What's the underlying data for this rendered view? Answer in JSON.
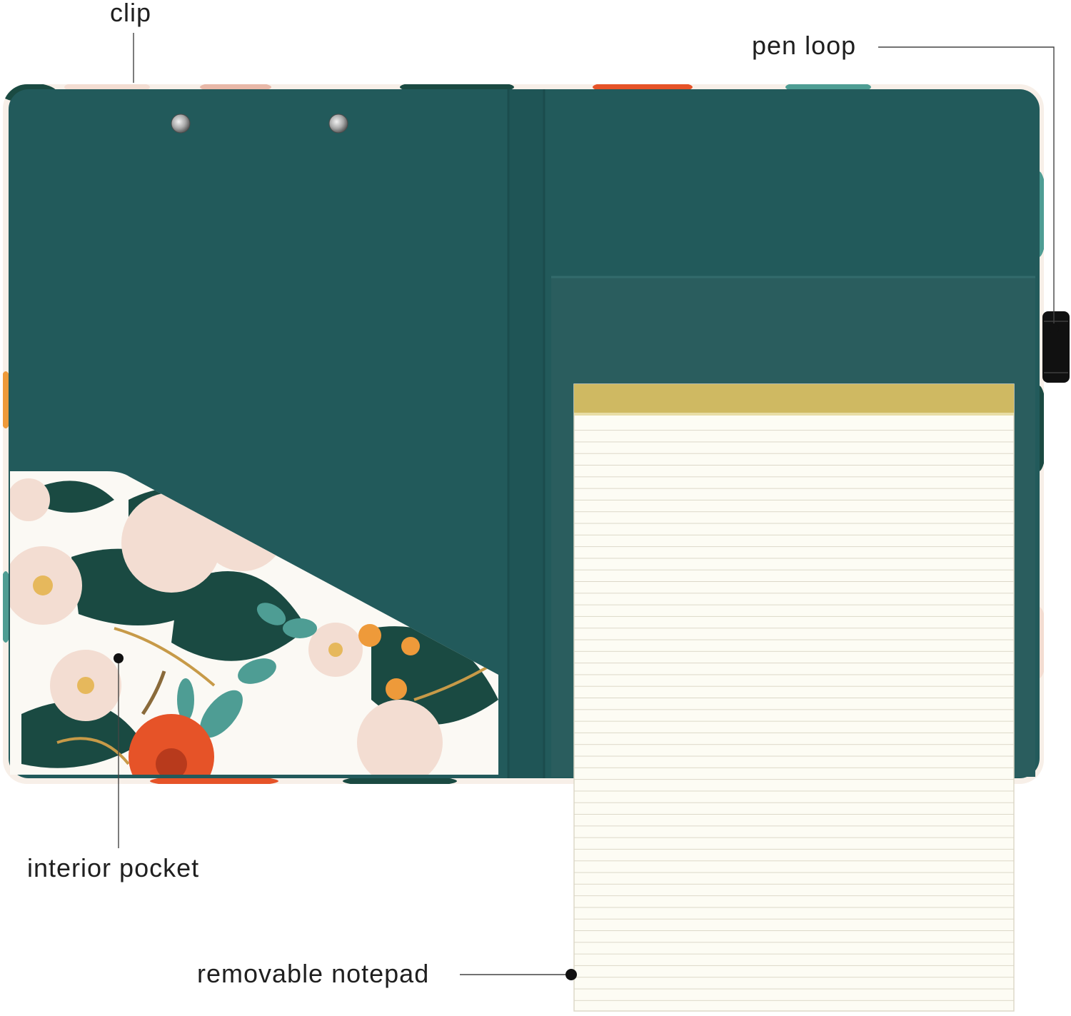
{
  "callouts": {
    "clip": "clip",
    "pen_loop": "pen loop",
    "interior_pocket": "interior pocket",
    "removable_notepad": "removable notepad"
  },
  "colors": {
    "cover_teal": "#225a5b",
    "spine_teal": "#1f5556",
    "pocket_teal": "#2a5d5e",
    "floral_white": "#fbf9f4",
    "petal_pink": "#f3ddd2",
    "leaf_dark": "#1a4a42",
    "leaf_sage": "#4e9d94",
    "flower_orange": "#e65328",
    "berry_orange": "#ee9a3a",
    "gold_stem": "#c79a48",
    "notepad_paper": "#fdfcf4",
    "notepad_binding": "#cfb962",
    "notepad_line": "#d9d5c4",
    "pen_loop_black": "#111111",
    "leader_line": "#444444"
  },
  "icons": {
    "rivets": "rivet-icon",
    "leader_dots": "leader-dot-icon"
  }
}
